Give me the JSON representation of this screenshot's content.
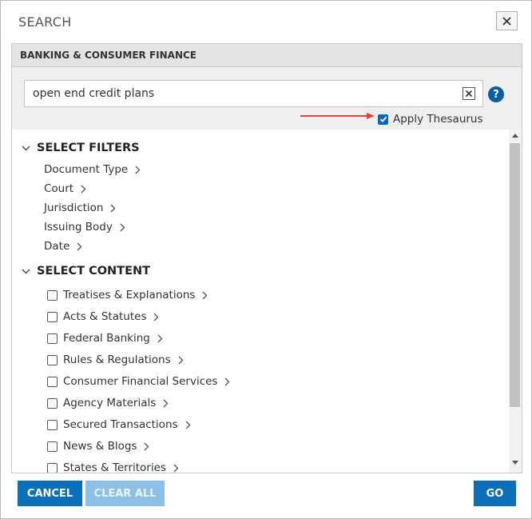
{
  "dialog": {
    "title": "SEARCH",
    "close_icon": "close-icon"
  },
  "panel": {
    "header": "BANKING & CONSUMER FINANCE"
  },
  "search": {
    "value": "open end credit plans",
    "placeholder": "",
    "help_label": "?",
    "thesaurus_label": "Apply Thesaurus",
    "thesaurus_checked": true
  },
  "filters": {
    "title": "SELECT FILTERS",
    "items": [
      {
        "label": "Document Type"
      },
      {
        "label": "Court"
      },
      {
        "label": "Jurisdiction"
      },
      {
        "label": "Issuing Body"
      },
      {
        "label": "Date"
      }
    ]
  },
  "content": {
    "title": "SELECT CONTENT",
    "items": [
      {
        "label": "Treatises & Explanations",
        "checked": false
      },
      {
        "label": "Acts & Statutes",
        "checked": false
      },
      {
        "label": "Federal Banking",
        "checked": false
      },
      {
        "label": "Rules & Regulations",
        "checked": false
      },
      {
        "label": "Consumer Financial Services",
        "checked": false
      },
      {
        "label": "Agency Materials",
        "checked": false
      },
      {
        "label": "Secured Transactions",
        "checked": false
      },
      {
        "label": "News & Blogs",
        "checked": false
      },
      {
        "label": "States & Territories",
        "checked": false
      }
    ]
  },
  "buttons": {
    "cancel": "CANCEL",
    "clear_all": "CLEAR ALL",
    "go": "GO"
  },
  "colors": {
    "primary_button": "#0b6fba",
    "disabled_button": "#8dc0e6",
    "help_icon": "#0b5ea1",
    "annotation_arrow": "#e8413a"
  }
}
